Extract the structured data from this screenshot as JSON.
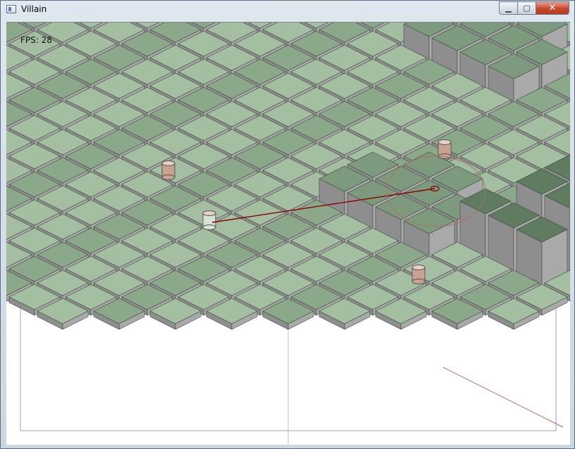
{
  "window": {
    "title": "Villain",
    "icon": "app-window-icon",
    "controls": {
      "minimize": "minimize-icon",
      "maximize": "maximize-icon",
      "close": "close-icon"
    }
  },
  "hud": {
    "fps": "FPS: 28"
  },
  "colors": {
    "tile_top": "#a4bea2",
    "tile_top_shade": "#8ba88a",
    "raised_top": "#7d9a7e",
    "high_top": "#5f7c61",
    "block_side_left": "#8e8e8e",
    "block_side_right": "#a9a9a9",
    "enemy": "#c9a291",
    "player": "#d8e2d4",
    "aim_line": "#8b0000"
  }
}
